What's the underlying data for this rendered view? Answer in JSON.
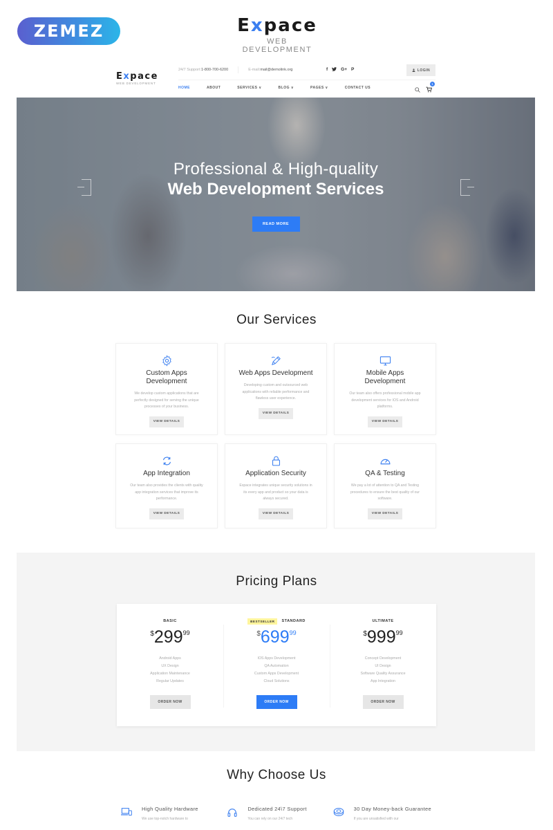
{
  "banner": {
    "vendor_logo": "ZEMEZ",
    "brand_prefix": "E",
    "brand_x": "x",
    "brand_suffix": "pace",
    "brand_tagline": "WEB DEVELOPMENT"
  },
  "header": {
    "logo_prefix": "E",
    "logo_x": "x",
    "logo_suffix": "pace",
    "logo_tagline": "WEB DEVELOPMENT",
    "support_label": "24/7 Support: ",
    "support_value": "1-800-700-6200",
    "email_label": "E-mail: ",
    "email_value": "mail@demolink.org",
    "social": [
      "f",
      "✦",
      "G+",
      "P"
    ],
    "login_label": "LOGIN",
    "nav": [
      {
        "label": "HOME",
        "active": true
      },
      {
        "label": "ABOUT"
      },
      {
        "label": "SERVICES ∨"
      },
      {
        "label": "BLOG ∨"
      },
      {
        "label": "PAGES ∨"
      },
      {
        "label": "CONTACT US"
      }
    ],
    "cart_count": "1"
  },
  "hero": {
    "line1": "Professional & High-quality",
    "line2": "Web Development Services",
    "button": "READ MORE"
  },
  "services": {
    "title": "Our Services",
    "button_label": "VIEW DETAILS",
    "items": [
      {
        "icon": "gear-icon",
        "title": "Custom Apps Development",
        "desc": "We develop custom applications that are perfectly designed for serving the unique processes of your business."
      },
      {
        "icon": "pencil-icon",
        "title": "Web Apps Development",
        "desc": "Developing custom and outsourced web applications with reliable performance and flawless user experience."
      },
      {
        "icon": "monitor-icon",
        "title": "Mobile Apps Development",
        "desc": "Our team also offers professional mobile app development services for IOS and Android platforms."
      },
      {
        "icon": "sync-icon",
        "title": "App Integration",
        "desc": "Our team also provides the clients with quality app integration services that improve its performance."
      },
      {
        "icon": "lock-icon",
        "title": "Application Security",
        "desc": "Expace integrates unique security solutions in its every app and product so your data is always secured."
      },
      {
        "icon": "gauge-icon",
        "title": "QA & Testing",
        "desc": "We pay a lot of attention to QA and Testing procedures to ensure the best quality of our software."
      }
    ]
  },
  "pricing": {
    "title": "Pricing Plans",
    "currency": "$",
    "order_label": "ORDER NOW",
    "plans": [
      {
        "name": "BASIC",
        "badge": "",
        "price_int": "299",
        "price_dec": "99",
        "features": [
          "Android Apps",
          "UX Design",
          "Application Maintenance",
          "Regular Updates"
        ]
      },
      {
        "name": "STANDARD",
        "badge": "BESTSELLER",
        "price_int": "699",
        "price_dec": "99",
        "features": [
          "IOS Apps Development",
          "QA Automation",
          "Custom Apps Development",
          "Cloud Solutions"
        ]
      },
      {
        "name": "ULTIMATE",
        "badge": "",
        "price_int": "999",
        "price_dec": "99",
        "features": [
          "Concept Development",
          "UI Design",
          "Software Quality Assurance",
          "App Integration"
        ]
      }
    ]
  },
  "why": {
    "title": "Why Choose Us",
    "items": [
      {
        "icon": "devices-icon",
        "title": "High Quality Hardware",
        "desc": "We use top-notch hardware to"
      },
      {
        "icon": "headset-icon",
        "title": "Dedicated 24\\7 Support",
        "desc": "You can rely on our 24/7 tech"
      },
      {
        "icon": "coins-icon",
        "title": "30 Day Money-back Guarantee",
        "desc": "If you are unsatisfied with our"
      }
    ]
  },
  "colors": {
    "accent": "#2d7cf6",
    "bestseller_badge": "#fff59d",
    "pricing_bg": "#f4f4f4"
  }
}
